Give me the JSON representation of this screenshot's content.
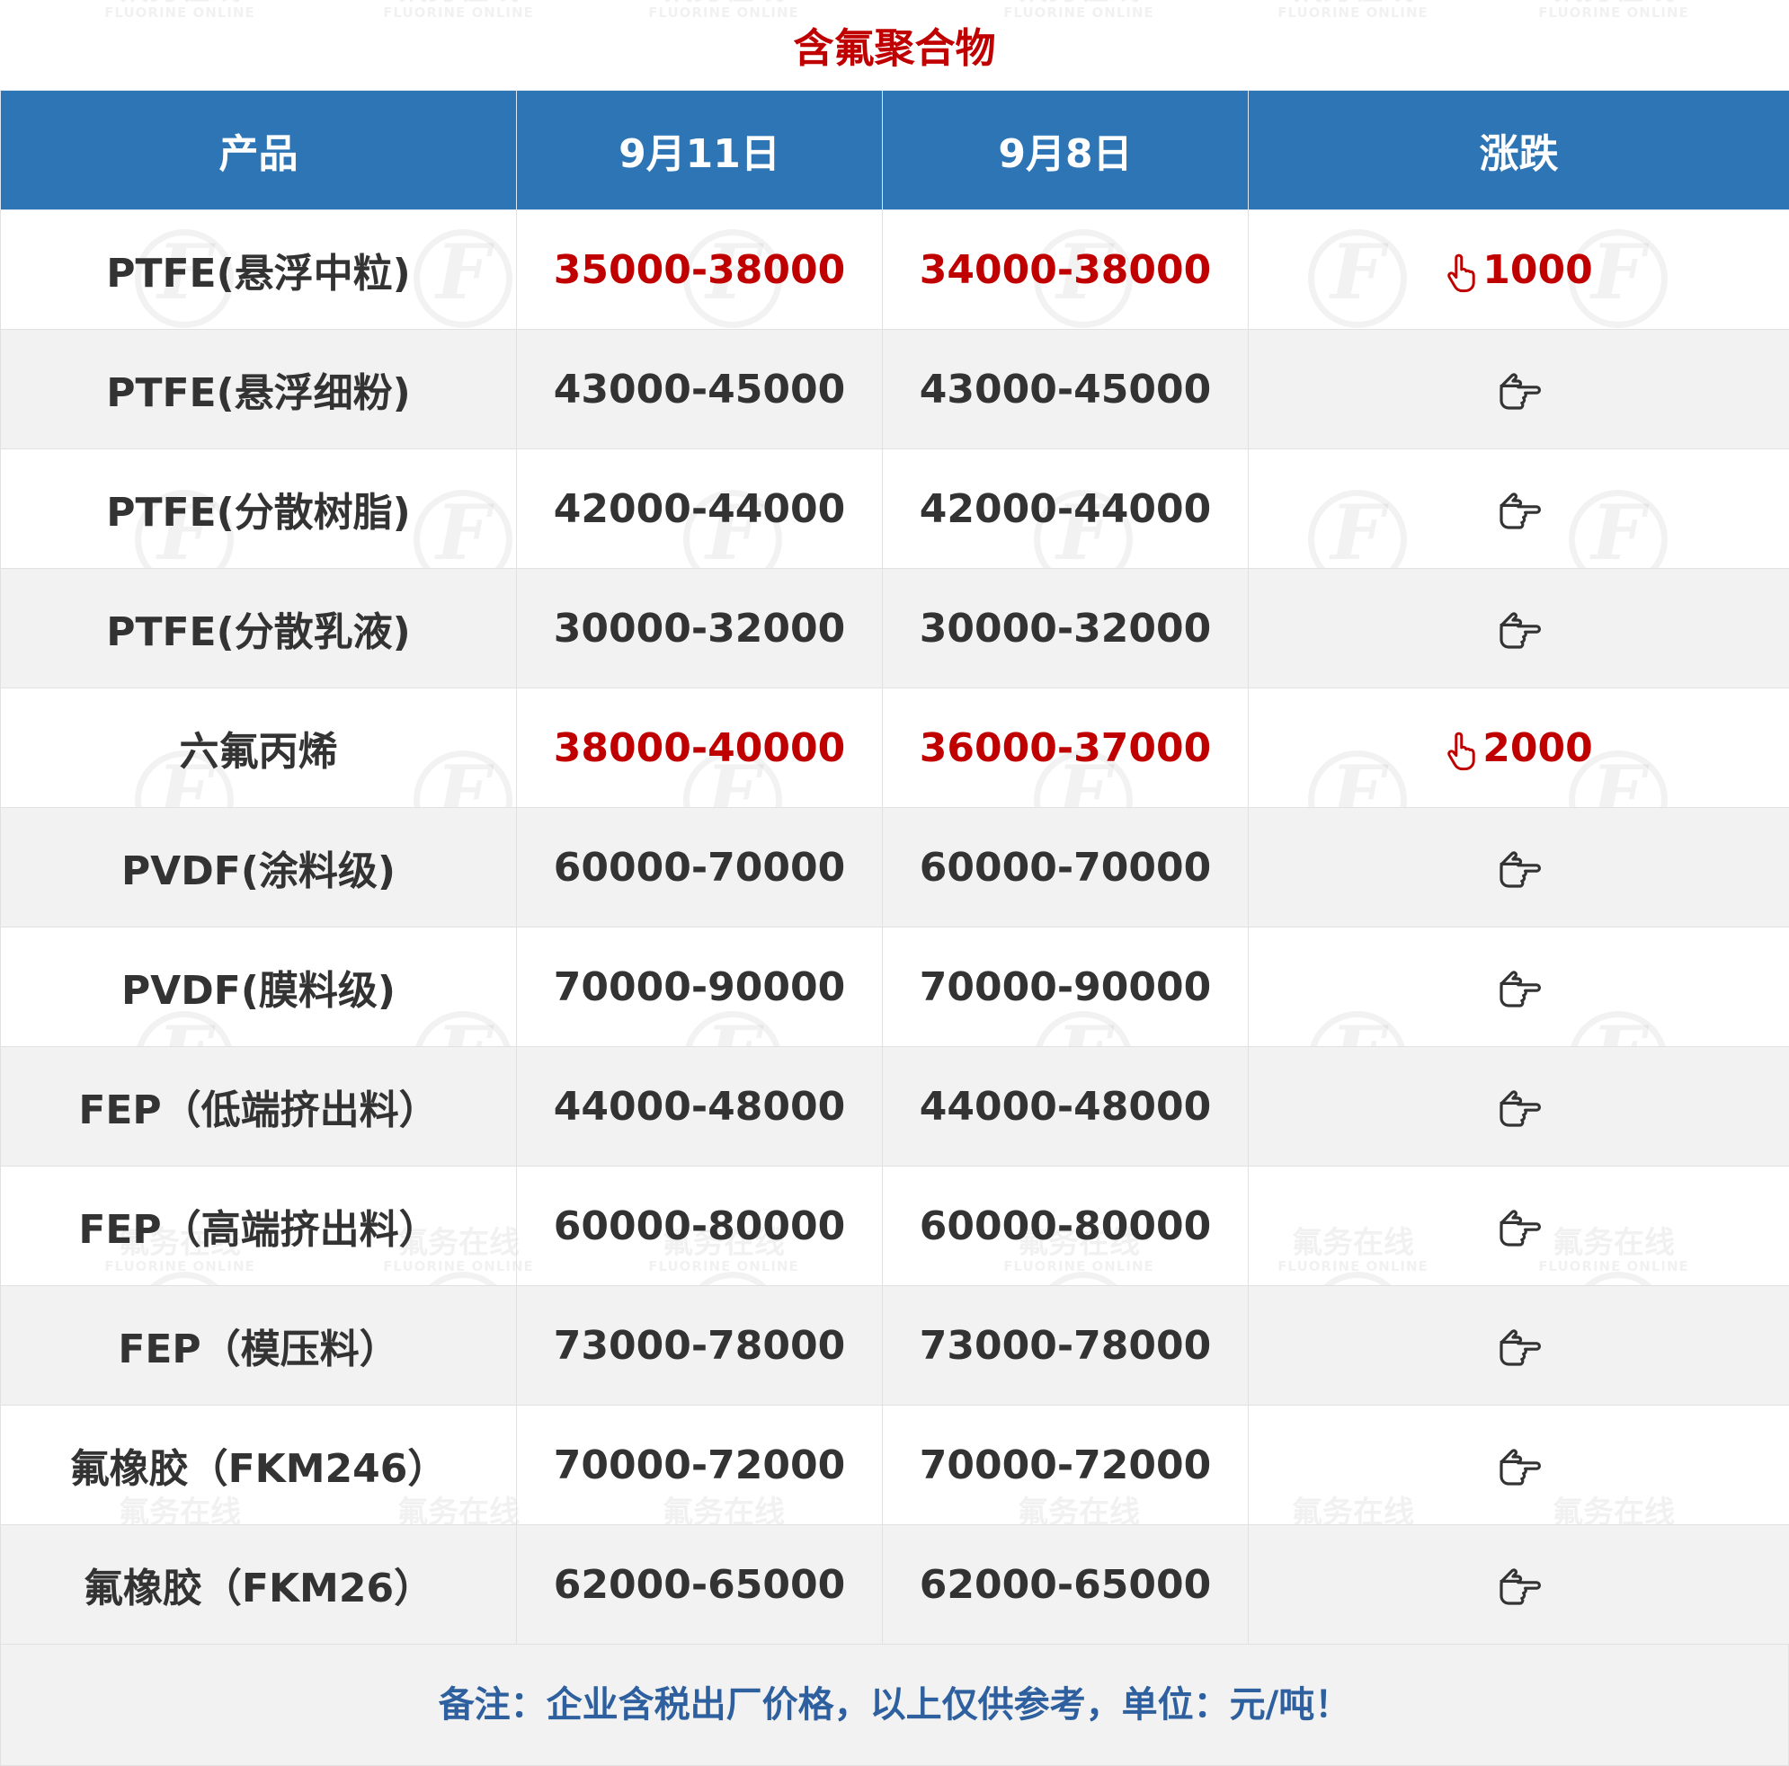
{
  "title": "含氟聚合物",
  "watermark": {
    "brand_cn": "氟务在线",
    "brand_en": "FLUORINE ONLINE",
    "logo_glyph": "F"
  },
  "table": {
    "headers": [
      "产品",
      "9月11日",
      "9月8日",
      "涨跌"
    ],
    "rows": [
      {
        "product": "PTFE(悬浮中粒)",
        "current": "35000-38000",
        "previous": "34000-38000",
        "change": "1000",
        "direction": "up"
      },
      {
        "product": "PTFE(悬浮细粉)",
        "current": "43000-45000",
        "previous": "43000-45000",
        "change": "",
        "direction": "flat"
      },
      {
        "product": "PTFE(分散树脂)",
        "current": "42000-44000",
        "previous": "42000-44000",
        "change": "",
        "direction": "flat"
      },
      {
        "product": "PTFE(分散乳液)",
        "current": "30000-32000",
        "previous": "30000-32000",
        "change": "",
        "direction": "flat"
      },
      {
        "product": "六氟丙烯",
        "current": "38000-40000",
        "previous": "36000-37000",
        "change": "2000",
        "direction": "up"
      },
      {
        "product": "PVDF(涂料级)",
        "current": "60000-70000",
        "previous": "60000-70000",
        "change": "",
        "direction": "flat"
      },
      {
        "product": "PVDF(膜料级)",
        "current": "70000-90000",
        "previous": "70000-90000",
        "change": "",
        "direction": "flat"
      },
      {
        "product": "FEP（低端挤出料）",
        "current": "44000-48000",
        "previous": "44000-48000",
        "change": "",
        "direction": "flat"
      },
      {
        "product": "FEP（高端挤出料）",
        "current": "60000-80000",
        "previous": "60000-80000",
        "change": "",
        "direction": "flat"
      },
      {
        "product": "FEP（模压料）",
        "current": "73000-78000",
        "previous": "73000-78000",
        "change": "",
        "direction": "flat"
      },
      {
        "product": "氟橡胶（FKM246）",
        "current": "70000-72000",
        "previous": "70000-72000",
        "change": "",
        "direction": "flat"
      },
      {
        "product": "氟橡胶（FKM26）",
        "current": "62000-65000",
        "previous": "62000-65000",
        "change": "",
        "direction": "flat"
      }
    ]
  },
  "note": "备注：企业含税出厂价格，以上仅供参考，单位：元/吨！",
  "colors": {
    "header_bg": "#2e75b6",
    "header_text": "#ffffff",
    "title": "#c00000",
    "rise": "#c00000",
    "body_text": "#333333",
    "stripe": "#f2f2f2",
    "note_text": "#2e5f9e"
  },
  "icons": {
    "up": "hand-pointing-up-icon",
    "flat": "hand-pointing-right-icon"
  }
}
